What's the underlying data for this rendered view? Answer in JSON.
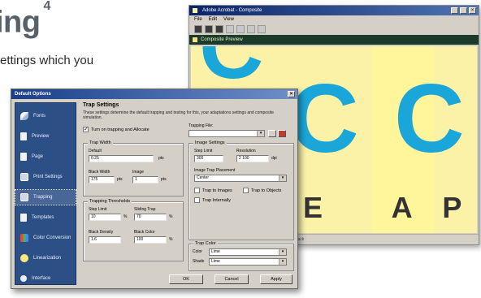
{
  "page": {
    "heading": "ing",
    "heading_sup": "4",
    "body_text": "ettings which you"
  },
  "preview_window": {
    "title": "Adobe Acrobat - Composite",
    "menu": [
      "File",
      "Edit",
      "View"
    ],
    "doc_tab": "Composite Preview",
    "canvas_letters": [
      "C",
      "C",
      "C"
    ],
    "canvas_text": "E   A P I",
    "status_text": "Some text 1 1 Everything and Black"
  },
  "dialog": {
    "title": "Default Options",
    "sidebar": [
      {
        "label": "Fonts",
        "icon": "feather-icon"
      },
      {
        "label": "Preview",
        "icon": "preview-icon"
      },
      {
        "label": "Page",
        "icon": "page-icon"
      },
      {
        "label": "Print Settings",
        "icon": "printer-icon"
      },
      {
        "label": "Trapping",
        "icon": "monitor-icon",
        "active": true
      },
      {
        "label": "Templates",
        "icon": "template-icon"
      },
      {
        "label": "Color Conversion",
        "icon": "swatch-icon"
      },
      {
        "label": "Linearization",
        "icon": "star-icon"
      },
      {
        "label": "Interface",
        "icon": "interface-icon"
      }
    ],
    "panel": {
      "title": "Trap Settings",
      "description": "These settings determine the default trapping and testing for this, your adaptations settings and composite simulation.",
      "enable_label": "Turn on trapping and Allocate",
      "trap_file_label": "Trapping File:",
      "trap_width": {
        "group": "Trap Width",
        "default_label": "Default",
        "default_value": "0.25",
        "default_unit": "pts",
        "black_width_label": "Black Width",
        "black_width_value": "175",
        "black_width_unit": "pts",
        "image_label": "Image",
        "image_value": "1",
        "image_unit": "pts"
      },
      "image_settings": {
        "group": "Image Settings",
        "step_limit_label": "Step Limit",
        "step_limit_value": "300",
        "resolution_label": "Resolution",
        "resolution_value": "2 100",
        "resolution_unit": "dpi",
        "placement_label": "Image Trap Placement",
        "placement_value": "Center",
        "trap_images_label": "Trap to Images",
        "trap_objects_label": "Trap to Objects",
        "internal_label": "Trap Internally"
      },
      "thresholds": {
        "group": "Trapping Thresholds",
        "step_label": "Step Limit",
        "step_value": "10",
        "step_unit": "%",
        "sliding_label": "Sliding Trap",
        "sliding_value": "70",
        "sliding_unit": "%",
        "black_density_label": "Black Density",
        "black_density_value": "1.6",
        "black_color_label": "Black Color",
        "black_color_value": "100",
        "black_color_unit": "%"
      },
      "trap_color": {
        "group": "Trap Color",
        "label_1": "Color",
        "value_1": "Lime",
        "label_2": "Shade",
        "value_2": "Lime"
      }
    },
    "buttons": {
      "ok": "OK",
      "cancel": "Cancel",
      "apply": "Apply"
    }
  }
}
